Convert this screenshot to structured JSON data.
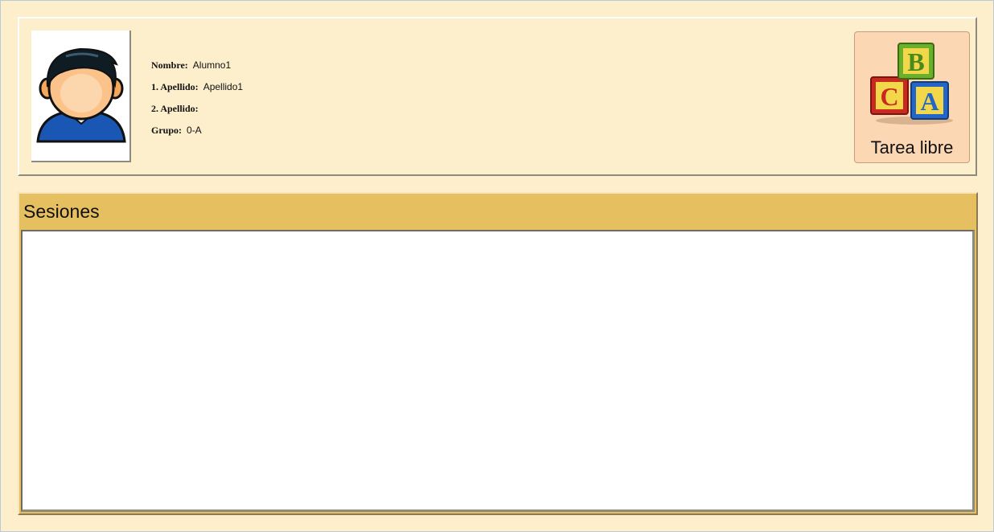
{
  "student": {
    "avatar_icon": "student-avatar-icon",
    "fields": [
      {
        "label": "Nombre:",
        "value": "Alumno1"
      },
      {
        "label": "1. Apellido:",
        "value": "Apellido1"
      },
      {
        "label": "2. Apellido:",
        "value": ""
      },
      {
        "label": "Grupo:",
        "value": "0-A"
      }
    ]
  },
  "free_task": {
    "label": "Tarea libre",
    "icon": "abc-blocks-icon"
  },
  "sessions": {
    "title": "Sesiones",
    "items": []
  },
  "colors": {
    "background": "#fdefcc",
    "sessions_header": "#e6bf61",
    "button_background": "#fbd7b4"
  }
}
